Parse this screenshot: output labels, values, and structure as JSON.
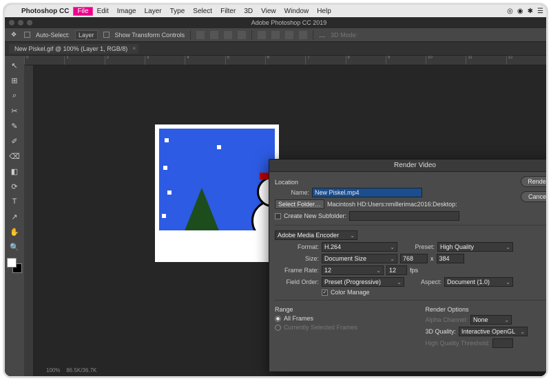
{
  "macmenu": {
    "app": "Photoshop CC",
    "items": [
      "File",
      "Edit",
      "Image",
      "Layer",
      "Type",
      "Select",
      "Filter",
      "3D",
      "View",
      "Window",
      "Help"
    ],
    "highlighted": "File",
    "tray": [
      "◎",
      "◉",
      "✱",
      "☰"
    ]
  },
  "window": {
    "title": "Adobe Photoshop CC 2019"
  },
  "optbar": {
    "autoselect_label": "Auto-Select:",
    "autoselect_target": "Layer",
    "transform_label": "Show Transform Controls",
    "mode3d": "3D Mode:"
  },
  "tab": {
    "label": "New Piskel.gif @ 100% (Layer 1, RGB/8)"
  },
  "ruler": {
    "ticks": [
      "0",
      "1",
      "2",
      "3",
      "4",
      "5",
      "6",
      "7",
      "8",
      "9",
      "10",
      "11",
      "12"
    ]
  },
  "dialog": {
    "title": "Render Video",
    "location_header": "Location",
    "name_label": "Name:",
    "name_value": "New Piskel.mp4",
    "select_folder_btn": "Select Folder…",
    "folder_path": "Macintosh HD:Users:nmillerimac2016:Desktop:",
    "create_subfolder_label": "Create New Subfolder:",
    "encoder": "Adobe Media Encoder",
    "format_label": "Format:",
    "format_value": "H.264",
    "preset_label": "Preset:",
    "preset_value": "High Quality",
    "size_label": "Size:",
    "size_value": "Document Size",
    "width": "768",
    "height": "384",
    "framerate_label": "Frame Rate:",
    "framerate_value": "12",
    "fps_value": "12",
    "fps_unit": "fps",
    "fieldorder_label": "Field Order:",
    "fieldorder_value": "Preset (Progressive)",
    "aspect_label": "Aspect:",
    "aspect_value": "Document (1.0)",
    "colormanage_label": "Color Manage",
    "range_header": "Range",
    "all_frames_label": "All Frames",
    "currently_selected_label": "Currently Selected Frames",
    "render_options_header": "Render Options",
    "alpha_channel_label": "Alpha Channel:",
    "alpha_channel_value": "None",
    "quality3d_label": "3D Quality:",
    "quality3d_value": "Interactive OpenGL",
    "hq_threshold_label": "High Quality Threshold:",
    "render_btn": "Render",
    "cancel_btn": "Cancel"
  },
  "status": {
    "zoom": "100%",
    "info": "86.5K/36.7K"
  },
  "tools": [
    "↖",
    "⊞",
    "⌕",
    "✂",
    "✎",
    "✐",
    "⌫",
    "◧",
    "⟳",
    "✎",
    "✎",
    "T",
    "↗",
    "✋",
    "◑"
  ]
}
